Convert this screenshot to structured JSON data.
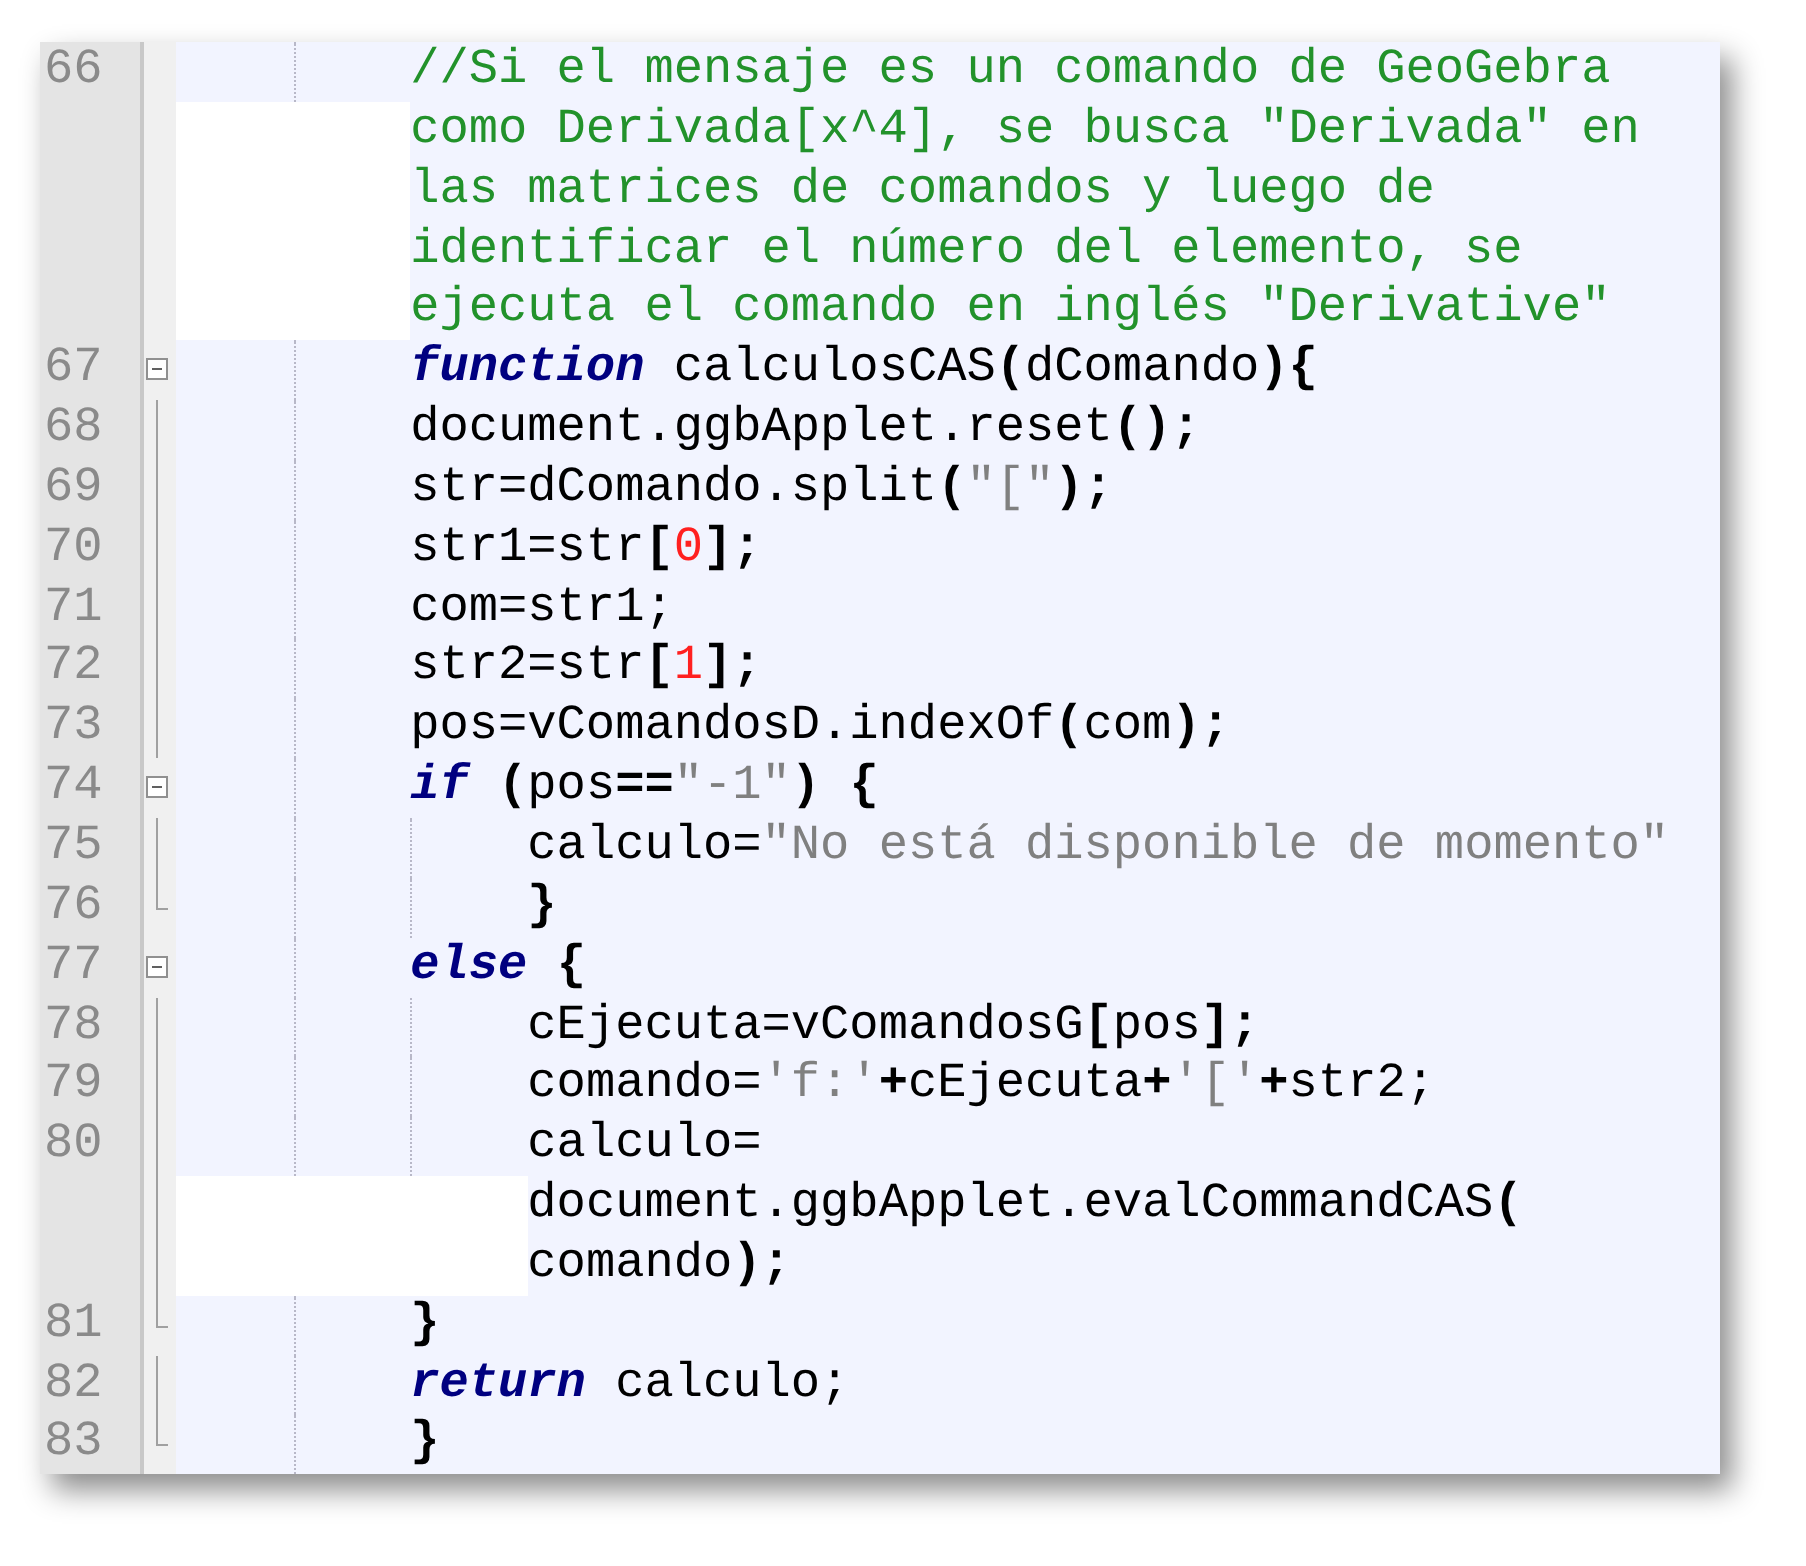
{
  "editor": {
    "lines": [
      {
        "number": "66",
        "in_block": false,
        "fold_start": false,
        "fold_end": false,
        "rows": [
          [
            {
              "kind": "comment",
              "text": "//Si el mensaje es un comando de GeoGebra"
            }
          ],
          [
            {
              "kind": "comment",
              "text": "como Derivada[x^4], se busca \"Derivada\" en"
            }
          ],
          [
            {
              "kind": "comment",
              "text": "las matrices de comandos y luego de"
            }
          ],
          [
            {
              "kind": "comment",
              "text": "identificar el número del elemento, se"
            }
          ],
          [
            {
              "kind": "comment",
              "text": "ejecuta el comando en inglés \"Derivative\""
            }
          ]
        ]
      },
      {
        "number": "67",
        "in_block": true,
        "fold_start": true,
        "fold_end": false,
        "rows": [
          [
            {
              "kind": "keyword",
              "text": "function"
            },
            {
              "kind": "plain",
              "text": " calculosCAS"
            },
            {
              "kind": "operator",
              "text": "("
            },
            {
              "kind": "plain",
              "text": "dComando"
            },
            {
              "kind": "operator",
              "text": "){"
            }
          ]
        ]
      },
      {
        "number": "68",
        "in_block": true,
        "fold_start": false,
        "fold_end": false,
        "rows": [
          [
            {
              "kind": "plain",
              "text": "document.ggbApplet.reset"
            },
            {
              "kind": "operator",
              "text": "();"
            }
          ]
        ]
      },
      {
        "number": "69",
        "in_block": true,
        "fold_start": false,
        "fold_end": false,
        "rows": [
          [
            {
              "kind": "plain",
              "text": "str=dComando.split"
            },
            {
              "kind": "operator",
              "text": "("
            },
            {
              "kind": "string",
              "text": "\"[\""
            },
            {
              "kind": "operator",
              "text": ");"
            }
          ]
        ]
      },
      {
        "number": "70",
        "in_block": true,
        "fold_start": false,
        "fold_end": false,
        "rows": [
          [
            {
              "kind": "plain",
              "text": "str1=str"
            },
            {
              "kind": "operator",
              "text": "["
            },
            {
              "kind": "number",
              "text": "0"
            },
            {
              "kind": "operator",
              "text": "];"
            }
          ]
        ]
      },
      {
        "number": "71",
        "in_block": true,
        "fold_start": false,
        "fold_end": false,
        "rows": [
          [
            {
              "kind": "plain",
              "text": "com=str1;"
            }
          ]
        ]
      },
      {
        "number": "72",
        "in_block": true,
        "fold_start": false,
        "fold_end": false,
        "rows": [
          [
            {
              "kind": "plain",
              "text": "str2=str"
            },
            {
              "kind": "operator",
              "text": "["
            },
            {
              "kind": "number",
              "text": "1"
            },
            {
              "kind": "operator",
              "text": "];"
            }
          ]
        ]
      },
      {
        "number": "73",
        "in_block": true,
        "fold_start": false,
        "fold_end": false,
        "rows": [
          [
            {
              "kind": "plain",
              "text": "pos=vComandosD.indexOf"
            },
            {
              "kind": "operator",
              "text": "("
            },
            {
              "kind": "plain",
              "text": "com"
            },
            {
              "kind": "operator",
              "text": ");"
            }
          ]
        ]
      },
      {
        "number": "74",
        "in_block": true,
        "fold_start": true,
        "fold_end": false,
        "rows": [
          [
            {
              "kind": "keyword",
              "text": "if"
            },
            {
              "kind": "plain",
              "text": " "
            },
            {
              "kind": "operator",
              "text": "("
            },
            {
              "kind": "plain",
              "text": "pos"
            },
            {
              "kind": "operator",
              "text": "=="
            },
            {
              "kind": "string",
              "text": "\"-1\""
            },
            {
              "kind": "operator",
              "text": ")"
            },
            {
              "kind": "plain",
              "text": " "
            },
            {
              "kind": "operator",
              "text": "{"
            }
          ]
        ],
        "children": [
          {
            "number": "75",
            "in_block": true,
            "fold_start": false,
            "fold_end": false,
            "rows": [
              [
                {
                  "kind": "plain",
                  "text": "calculo="
                },
                {
                  "kind": "string",
                  "text": "\"No está disponible de momento\""
                }
              ]
            ]
          },
          {
            "number": "76",
            "in_block": true,
            "fold_start": false,
            "fold_end": true,
            "rows": [
              [
                {
                  "kind": "operator",
                  "text": "}"
                }
              ]
            ]
          }
        ]
      },
      {
        "number": "77",
        "in_block": true,
        "fold_start": true,
        "fold_end": false,
        "rows": [
          [
            {
              "kind": "keyword",
              "text": "else"
            },
            {
              "kind": "plain",
              "text": " "
            },
            {
              "kind": "operator",
              "text": "{"
            }
          ]
        ],
        "children": [
          {
            "number": "78",
            "in_block": true,
            "fold_start": false,
            "fold_end": false,
            "rows": [
              [
                {
                  "kind": "plain",
                  "text": "cEjecuta=vComandosG"
                },
                {
                  "kind": "operator",
                  "text": "["
                },
                {
                  "kind": "plain",
                  "text": "pos"
                },
                {
                  "kind": "operator",
                  "text": "];"
                }
              ]
            ]
          },
          {
            "number": "79",
            "in_block": true,
            "fold_start": false,
            "fold_end": false,
            "rows": [
              [
                {
                  "kind": "plain",
                  "text": "comando="
                },
                {
                  "kind": "string",
                  "text": "'f:'"
                },
                {
                  "kind": "operator",
                  "text": "+"
                },
                {
                  "kind": "plain",
                  "text": "cEjecuta"
                },
                {
                  "kind": "operator",
                  "text": "+"
                },
                {
                  "kind": "string",
                  "text": "'['"
                },
                {
                  "kind": "operator",
                  "text": "+"
                },
                {
                  "kind": "plain",
                  "text": "str2;"
                }
              ]
            ]
          },
          {
            "number": "80",
            "in_block": true,
            "fold_start": false,
            "fold_end": false,
            "rows": [
              [
                {
                  "kind": "plain",
                  "text": "calculo="
                }
              ],
              [
                {
                  "kind": "plain",
                  "text": "document.ggbApplet.evalCommandCAS"
                },
                {
                  "kind": "operator",
                  "text": "("
                }
              ],
              [
                {
                  "kind": "plain",
                  "text": "comando"
                },
                {
                  "kind": "operator",
                  "text": ");"
                }
              ]
            ]
          }
        ]
      },
      {
        "number": "81",
        "in_block": true,
        "fold_start": false,
        "fold_end": true,
        "rows": [
          [
            {
              "kind": "operator",
              "text": "}"
            }
          ]
        ]
      },
      {
        "number": "82",
        "in_block": true,
        "fold_start": false,
        "fold_end": false,
        "rows": [
          [
            {
              "kind": "keyword",
              "text": "return"
            },
            {
              "kind": "plain",
              "text": " calculo;"
            }
          ]
        ]
      },
      {
        "number": "83",
        "in_block": true,
        "fold_start": false,
        "fold_end": true,
        "rows": [
          [
            {
              "kind": "operator",
              "text": "}"
            }
          ]
        ]
      }
    ]
  }
}
